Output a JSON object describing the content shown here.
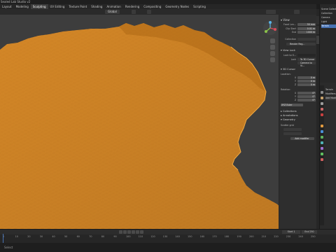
{
  "title_bar": {
    "text": "Sealed Lab Studio v2"
  },
  "workspaces": [
    "Layout",
    "Modeling",
    "Sculpting",
    "UV Editing",
    "Texture Paint",
    "Shading",
    "Animation",
    "Rendering",
    "Compositing",
    "Geometry Nodes",
    "Scripting"
  ],
  "active_workspace": "Sculpting",
  "viewport_header": {
    "mode": "Global"
  },
  "colors": {
    "mesh": "#e8962e",
    "mesh_edge": "#b86a10",
    "viewport_bg": "#3d3d3d",
    "panel_bg": "#2e2e2e",
    "accent": "#4772b3"
  },
  "n_panel": {
    "view_title": "View",
    "focal_label": "Focal Len...",
    "focal_value": "50 mm",
    "clip_start_label": "Clip Start",
    "clip_start_value": "0.01 m",
    "clip_end_label": "End",
    "clip_end_value": "1000 m",
    "collection_label": "Collection",
    "render_region_label": "Render Reg...",
    "view_lock_title": "View Lock",
    "lock_object_label": "Lock to O...",
    "lock_label": "Lock",
    "lock_cursor": "To 3D Cursor",
    "camera_to_view": "Camera to Vi...",
    "cursor_title": "3D Cursor",
    "location_label": "Location:",
    "loc_x": "0 m",
    "loc_y": "0 m",
    "loc_z": "0 m",
    "rotation_label": "Rotation:",
    "rot_x": "0°",
    "rot_y": "0°",
    "rot_z": "0°",
    "rotation_mode": "XYZ Euler",
    "collections_title": "Collections",
    "annotations_title": "Annotations",
    "geometry_title": "Geometry",
    "scatter_title": "Scatter grid",
    "add_modifier": "Add modifier"
  },
  "outliner": {
    "rows": [
      "Scene Collection",
      "Collection",
      "Camera",
      "Light",
      "Terrain"
    ]
  },
  "properties": {
    "rows": [
      "Terrain",
      "Modifiers",
      "Add Modifier"
    ]
  },
  "timeline": {
    "ticks": [
      "0",
      "10",
      "20",
      "30",
      "40",
      "50",
      "60",
      "70",
      "80",
      "90",
      "100",
      "110",
      "120",
      "130",
      "140",
      "150",
      "160",
      "170",
      "180",
      "190",
      "200",
      "210",
      "220",
      "230",
      "240",
      "250"
    ],
    "start_label": "Start",
    "start_value": "1",
    "end_label": "End",
    "end_value": "250",
    "current_frame": "1"
  },
  "status": {
    "text": "Select"
  }
}
